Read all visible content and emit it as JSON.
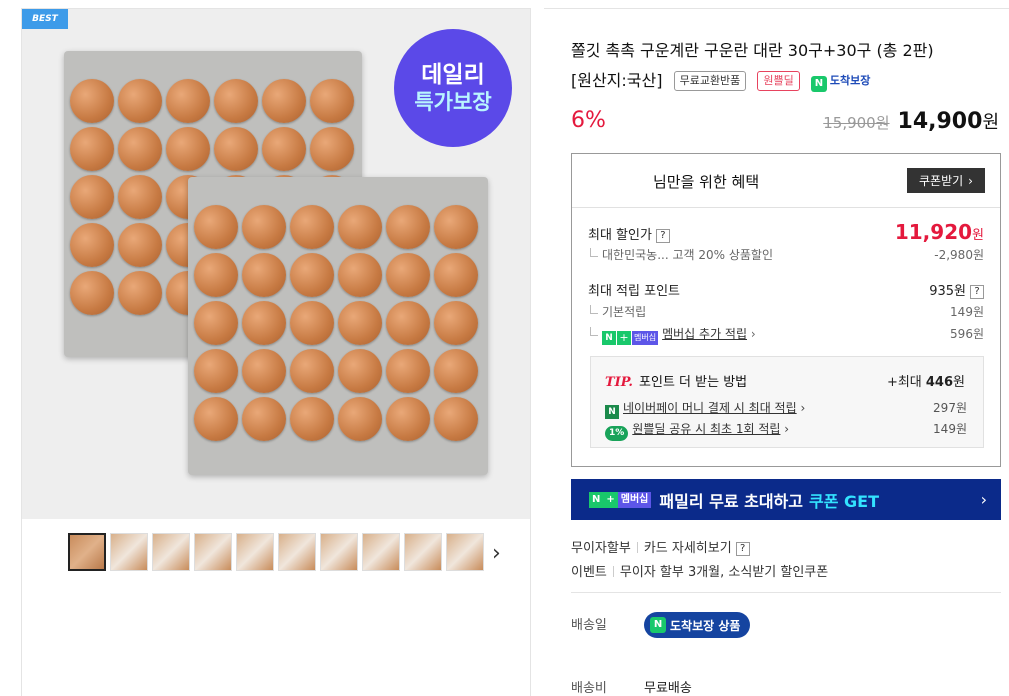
{
  "gallery": {
    "best_label": "BEST",
    "badge_line1": "데일리",
    "badge_line2": "특가보장",
    "thumbnail_count": 10
  },
  "product": {
    "title": "쫄깃 촉촉 구운계란 구운란 대란 30구+30구 (총 2판)",
    "origin": "[원산지:국산]",
    "tags": [
      "무료교환반품",
      "원쁠딜"
    ],
    "delivery_tag": "도착보장",
    "discount_rate": "6%",
    "original_price": "15,900원",
    "sale_price": "14,900",
    "sale_price_unit": "원"
  },
  "benefits": {
    "title": "님만을 위한 혜택",
    "coupon_button": "쿠폰받기",
    "max_discount_label": "최대 할인가",
    "max_discount_value": "11,920",
    "max_discount_unit": "원",
    "discount_detail_label": "대한민국농... 고객 20% 상품할인",
    "discount_detail_value": "-2,980원",
    "max_points_label": "최대 적립 포인트",
    "max_points_value": "935원",
    "basic_points_label": "기본적립",
    "basic_points_value": "149원",
    "membership_points_label": "멤버십 추가 적립",
    "membership_points_value": "596원",
    "membership_chip": "멤버십",
    "tip_label": "TIP.",
    "tip_title": "포인트 더 받는 방법",
    "tip_max_prefix": "+최대 ",
    "tip_max_value": "446",
    "tip_max_unit": "원",
    "tip_items": [
      {
        "label": "네이버페이 머니 결제 시 최대 적립",
        "value": "297원",
        "icon": "N"
      },
      {
        "label": "원쁠딜 공유 시 최초 1회 적립",
        "value": "149원",
        "icon": "1%"
      }
    ]
  },
  "family_banner": {
    "chip": "멤버십",
    "text": "패밀리 무료 초대하고",
    "highlight": "쿠폰 GET"
  },
  "payment": {
    "installment": "무이자할부",
    "card_detail": "카드 자세히보기",
    "event_label": "이벤트",
    "event_text": "무이자 할부 3개월, 소식받기 할인쿠폰"
  },
  "shipping": {
    "date_label": "배송일",
    "badge": "도착보장 상품",
    "fee_label": "배송비",
    "fee_value": "무료배송"
  },
  "colors": {
    "accent_red": "#e4193d",
    "naver_green": "#19c86b",
    "banner_navy": "#0b2a8a",
    "badge_purple": "#5b49e8"
  }
}
